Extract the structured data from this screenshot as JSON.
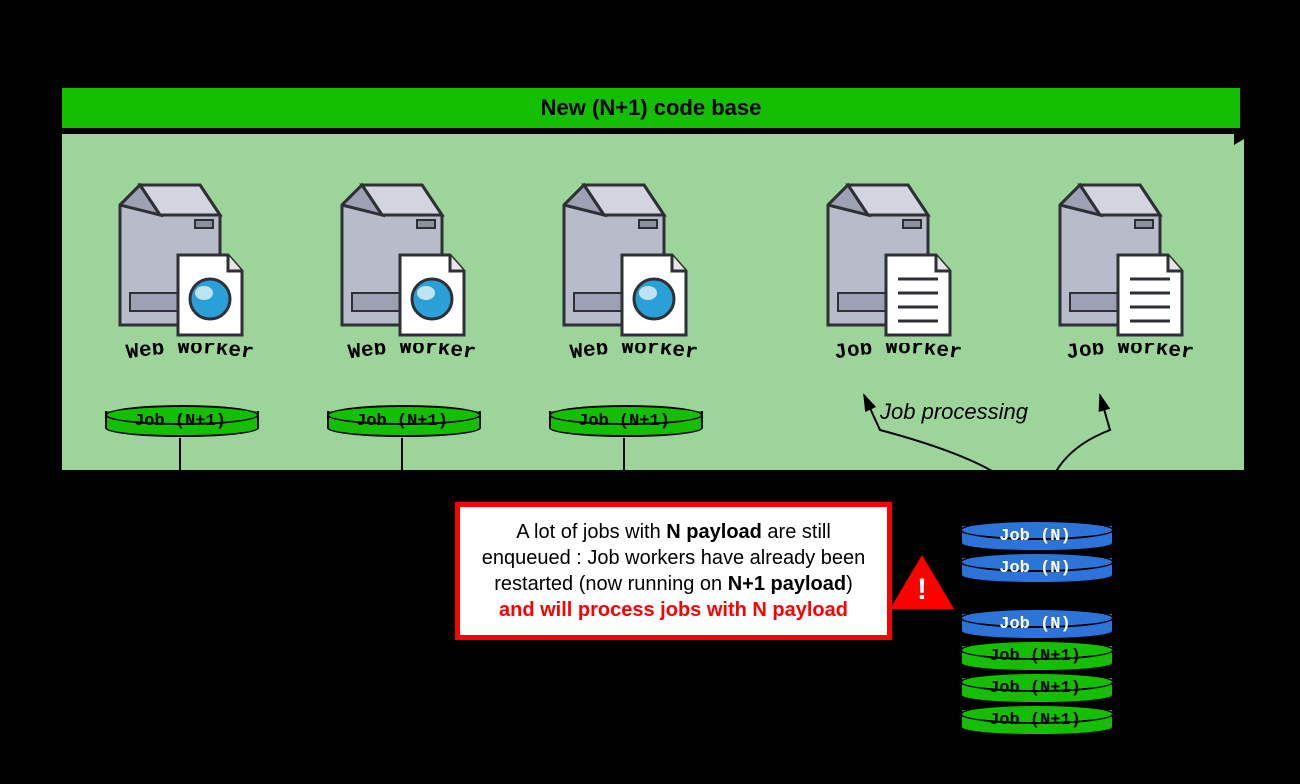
{
  "header": {
    "title": "New (N+1) code base"
  },
  "servers": {
    "web": {
      "label": "Web Worker",
      "disk": "Job (N+1)"
    },
    "job": {
      "label": "Job Worker"
    }
  },
  "processing_label": "Job processing",
  "note": {
    "prefix": "A lot of jobs with ",
    "bold1": "N payload",
    "mid1": " are still enqueued : Job workers have already been restarted (now running on ",
    "bold2": "N+1 payload",
    "mid2": ") ",
    "red": "and will process jobs with N payload"
  },
  "warning_glyph": "!",
  "queue": {
    "old": "Job (N)",
    "new": "Job (N+1)"
  },
  "colors": {
    "green": "#13bf00",
    "blue": "#2d74d8",
    "red": "#ff0000"
  }
}
